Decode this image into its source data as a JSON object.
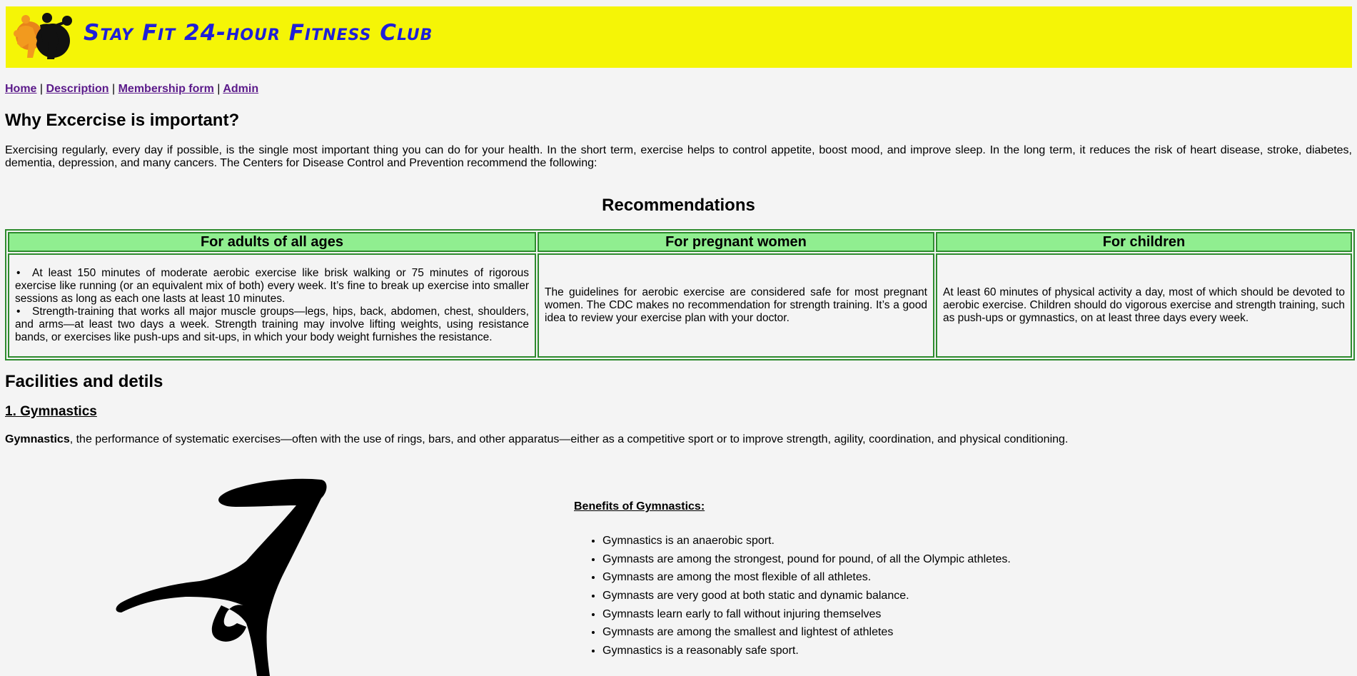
{
  "site": {
    "title": "Stay Fit 24-hour Fitness Club",
    "banner_color": "#f5f506",
    "title_color": "#1f1fd8",
    "logo_icon": "fitness-people-logo"
  },
  "nav": {
    "items": [
      {
        "label": "Home"
      },
      {
        "label": "Description"
      },
      {
        "label": "Membership form"
      },
      {
        "label": "Admin"
      }
    ],
    "separator": "|",
    "link_color": "#5b1a8a"
  },
  "why": {
    "heading": "Why Excercise is important?",
    "text": "Exercising regularly, every day if possible, is the single most important thing you can do for your health. In the short term, exercise helps to control appetite, boost mood, and improve sleep. In the long term, it reduces the risk of heart disease, stroke, diabetes, dementia, depression, and many cancers. The Centers for Disease Control and Prevention recommend the following:"
  },
  "recommendations": {
    "heading": "Recommendations",
    "header_color": "#90ee90",
    "border_color": "#2e8b2e",
    "columns": [
      {
        "header": "For adults of all ages"
      },
      {
        "header": "For pregnant women"
      },
      {
        "header": "For children"
      }
    ],
    "adults_items": [
      "At least 150 minutes of moderate aerobic exercise like brisk walking or 75 minutes of rigorous exercise like running (or an equivalent mix of both) every week. It’s fine to break up exercise into smaller sessions as long as each one lasts at least 10 minutes.",
      "Strength-training that works all major muscle groups—legs, hips, back, abdomen, chest, shoulders, and arms—at least two days a week. Strength training may involve lifting weights, using resistance bands, or exercises like push-ups and sit-ups, in which your body weight furnishes the resistance."
    ],
    "pregnant_text": "The guidelines for aerobic exercise are considered safe for most pregnant women. The CDC makes no recommendation for strength training. It’s a good idea to review your exercise plan with your doctor.",
    "children_text": "At least 60 minutes of physical activity a day, most of which should be devoted to aerobic exercise. Children should do vigorous exercise and strength training, such as push-ups or gymnastics, on at least three days every week."
  },
  "facilities": {
    "heading": "Facilities and detils",
    "gymnastics": {
      "heading": "1. Gymnastics",
      "term": "Gymnastics",
      "description": ", the performance of systematic exercises—often with the use of rings, bars, and other apparatus—either as a competitive sport or to improve strength, agility, coordination, and physical conditioning.",
      "image_icon": "gymnast-silhouette",
      "benefits_title": "Benefits of Gymnastics:",
      "benefits": [
        "Gymnastics is an anaerobic sport.",
        "Gymnasts are among the strongest, pound for pound, of all the Olympic athletes.",
        "Gymnasts are among the most flexible of all athletes.",
        "Gymnasts are very good at both static and dynamic balance.",
        "Gymnasts learn early to fall without injuring themselves",
        "Gymnasts are among the smallest and lightest of athletes",
        "Gymnastics is a reasonably safe sport."
      ]
    }
  }
}
